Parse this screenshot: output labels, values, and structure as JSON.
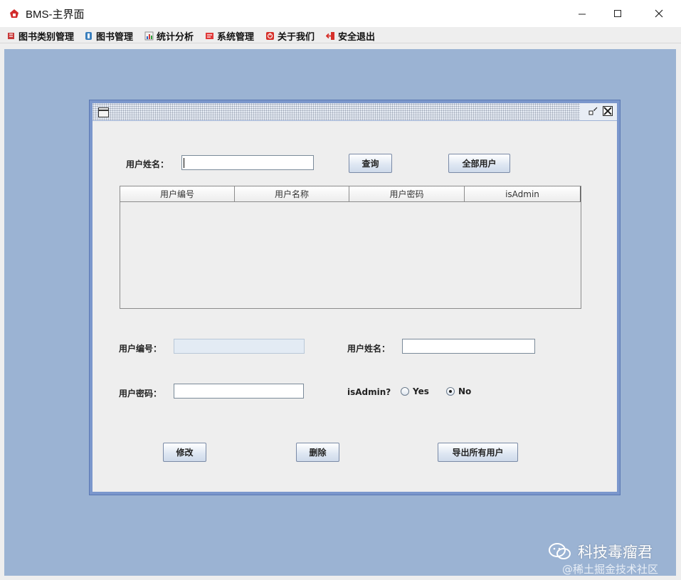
{
  "window": {
    "title": "BMS-主界面"
  },
  "menu": [
    {
      "label": "图书类别管理",
      "icon": "book-category-icon"
    },
    {
      "label": "图书管理",
      "icon": "book-icon"
    },
    {
      "label": "统计分析",
      "icon": "chart-icon"
    },
    {
      "label": "系统管理",
      "icon": "system-settings-icon"
    },
    {
      "label": "关于我们",
      "icon": "about-icon"
    },
    {
      "label": "安全退出",
      "icon": "exit-icon"
    }
  ],
  "search": {
    "name_label": "用户姓名：",
    "name_value": "",
    "query_button": "查询",
    "all_users_button": "全部用户"
  },
  "table": {
    "columns": [
      "用户编号",
      "用户名称",
      "用户密码",
      "isAdmin"
    ],
    "rows": []
  },
  "form": {
    "id_label": "用户编号：",
    "id_value": "",
    "name_label": "用户姓名：",
    "name_value": "",
    "password_label": "用户密码：",
    "password_value": "",
    "isadmin_label": "isAdmin?",
    "yes_label": "Yes",
    "no_label": "No",
    "selected": "No"
  },
  "actions": {
    "modify_button": "修改",
    "delete_button": "删除",
    "export_button": "导出所有用户"
  },
  "watermark": {
    "line1": "科技毒瘤君",
    "line2": "@稀土掘金技术社区"
  },
  "colors": {
    "desktop": "#9bb3d3",
    "frame_border": "#7b97cc",
    "panel": "#eeeeee"
  }
}
